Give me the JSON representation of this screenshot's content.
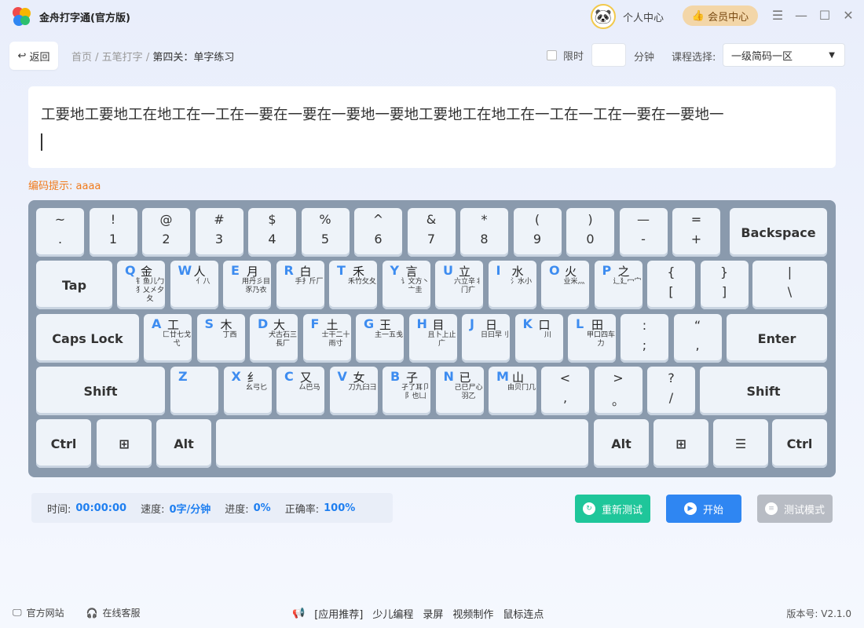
{
  "app": {
    "title": "金舟打字通(官方版)"
  },
  "header": {
    "personal": "个人中心",
    "member": "会员中心"
  },
  "nav": {
    "back": "返回",
    "crumbs": [
      "首页",
      "五笔打字"
    ],
    "current": "第四关：单字练习"
  },
  "options": {
    "limit_label": "限时",
    "minutes_value": "",
    "minutes_label": "分钟",
    "course_label": "课程选择:",
    "course_value": "一级简码一区"
  },
  "practice": {
    "text": "工要地工要地工在地工在一工在一要在一要在一要地一要地工要地工在地工在一工在一工在一要在一要地一",
    "hint_label": "编码提示:",
    "hint_value": "aaaa"
  },
  "keyboard": {
    "row1": [
      {
        "top": "~",
        "bot": "."
      },
      {
        "top": "!",
        "bot": "1"
      },
      {
        "top": "@",
        "bot": "2"
      },
      {
        "top": "#",
        "bot": "3"
      },
      {
        "top": "$",
        "bot": "4"
      },
      {
        "top": "%",
        "bot": "5"
      },
      {
        "top": "^",
        "bot": "6"
      },
      {
        "top": "&",
        "bot": "7"
      },
      {
        "top": "*",
        "bot": "8"
      },
      {
        "top": "(",
        "bot": "9"
      },
      {
        "top": ")",
        "bot": "0"
      },
      {
        "top": "—",
        "bot": "-"
      },
      {
        "top": "=",
        "bot": "+"
      }
    ],
    "backspace": "Backspace",
    "tab": "Tap",
    "row2": [
      {
        "letter": "Q",
        "char": "金",
        "roots": "钅鱼儿勹犭乂㐅夕夂"
      },
      {
        "letter": "W",
        "char": "人",
        "roots": "亻八"
      },
      {
        "letter": "E",
        "char": "月",
        "roots": "用丹彡目豕乃衣"
      },
      {
        "letter": "R",
        "char": "白",
        "roots": "手扌斤厂"
      },
      {
        "letter": "T",
        "char": "禾",
        "roots": "禾竹攵夂"
      },
      {
        "letter": "Y",
        "char": "言",
        "roots": "讠文方丶亠圭"
      },
      {
        "letter": "U",
        "char": "立",
        "roots": "六立辛丬门疒"
      },
      {
        "letter": "I",
        "char": "水",
        "roots": "氵水小"
      },
      {
        "letter": "O",
        "char": "火",
        "roots": "业米灬"
      },
      {
        "letter": "P",
        "char": "之",
        "roots": "辶廴冖宀"
      }
    ],
    "row2_sym": [
      {
        "top": "{",
        "bot": "["
      },
      {
        "top": "}",
        "bot": "]"
      },
      {
        "top": "|",
        "bot": "\\"
      }
    ],
    "caps": "Caps Lock",
    "row3": [
      {
        "letter": "A",
        "char": "工",
        "roots": "匚廿七戈弋"
      },
      {
        "letter": "S",
        "char": "木",
        "roots": "丁西"
      },
      {
        "letter": "D",
        "char": "大",
        "roots": "犬古石三長厂"
      },
      {
        "letter": "F",
        "char": "土",
        "roots": "士干二十雨寸"
      },
      {
        "letter": "G",
        "char": "王",
        "roots": "主一五戋"
      },
      {
        "letter": "H",
        "char": "目",
        "roots": "且卜上止广"
      },
      {
        "letter": "J",
        "char": "日",
        "roots": "日曰早刂"
      },
      {
        "letter": "K",
        "char": "口",
        "roots": "川"
      },
      {
        "letter": "L",
        "char": "田",
        "roots": "甲口四车力"
      }
    ],
    "row3_sym": [
      {
        "top": ":",
        "bot": ";"
      },
      {
        "top": "“",
        "bot": ","
      }
    ],
    "enter": "Enter",
    "shift": "Shift",
    "row4": [
      {
        "letter": "Z",
        "char": "",
        "roots": ""
      },
      {
        "letter": "X",
        "char": "纟",
        "roots": "幺弓匕"
      },
      {
        "letter": "C",
        "char": "又",
        "roots": "厶巴马"
      },
      {
        "letter": "V",
        "char": "女",
        "roots": "刀九臼彐"
      },
      {
        "letter": "B",
        "char": "子",
        "roots": "孑了耳卩阝也凵"
      },
      {
        "letter": "N",
        "char": "已",
        "roots": "己巳尸心羽乙"
      },
      {
        "letter": "M",
        "char": "山",
        "roots": "由贝冂几"
      }
    ],
    "row4_sym": [
      {
        "top": "<",
        "bot": ","
      },
      {
        "top": ">",
        "bot": "。"
      },
      {
        "top": "?",
        "bot": "/"
      }
    ],
    "ctrl": "Ctrl",
    "alt": "Alt"
  },
  "stats": {
    "time_label": "时间:",
    "time": "00:00:00",
    "speed_label": "速度:",
    "speed": "0字/分钟",
    "progress_label": "进度:",
    "progress": "0%",
    "accuracy_label": "正确率:",
    "accuracy": "100%"
  },
  "actions": {
    "retest": "重新测试",
    "start": "开始",
    "test_mode": "测试模式"
  },
  "colors": {
    "retest": "#1fc69a",
    "start": "#2f86f2",
    "test_mode": "#b8bcc4",
    "accent": "#f07a1a",
    "member_bg": "#f3d6a8"
  },
  "footer": {
    "website": "官方网站",
    "support": "在线客服",
    "recommend": "[应用推荐]",
    "links": [
      "少儿编程",
      "录屏",
      "视频制作",
      "鼠标连点"
    ],
    "version_label": "版本号:",
    "version": "V2.1.0"
  }
}
